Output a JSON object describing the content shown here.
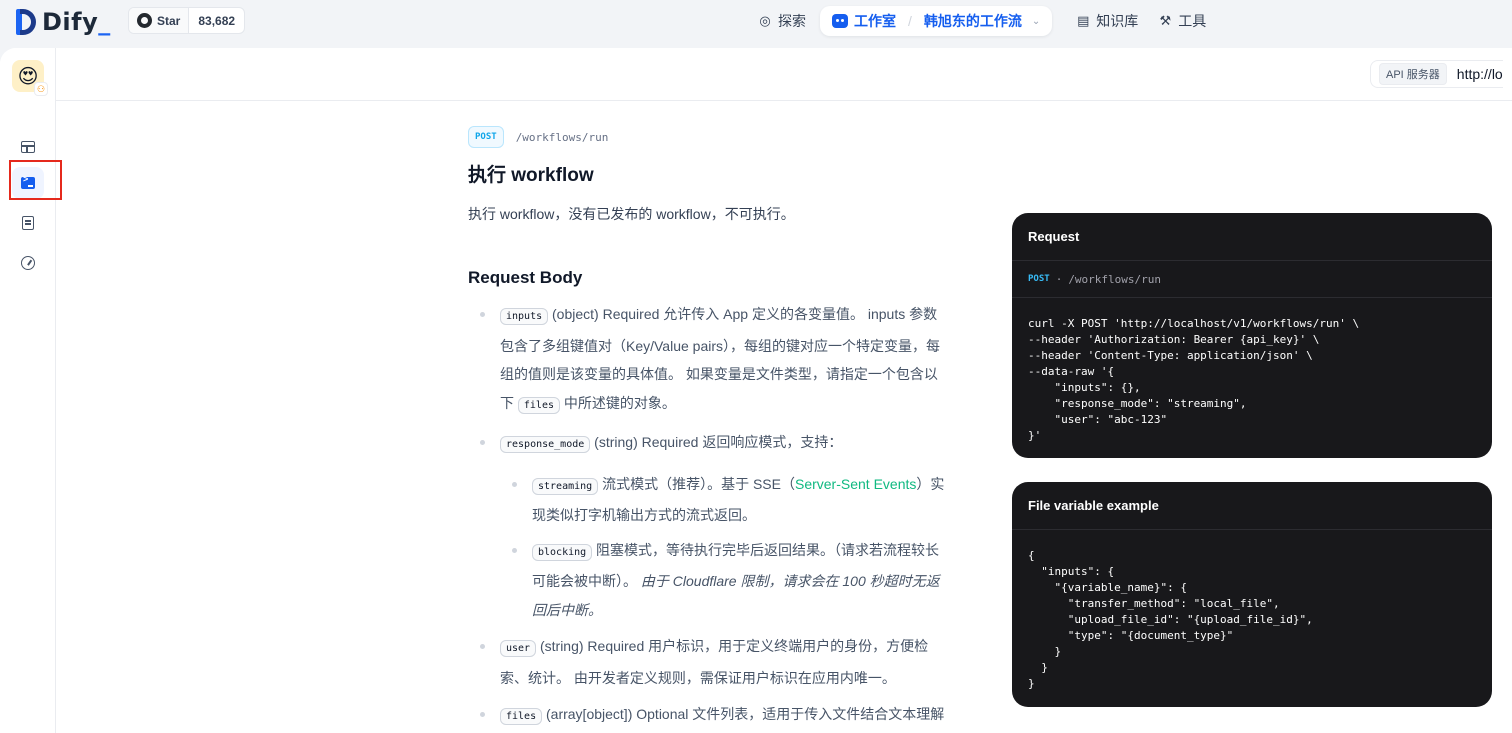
{
  "brand": {
    "name": "Dify",
    "accent": "#155eef"
  },
  "github": {
    "star_label": "Star",
    "star_count": "83,682"
  },
  "nav": {
    "explore": "探索",
    "studio": "工作室",
    "current_app": "韩旭东的工作流",
    "knowledge": "知识库",
    "tools": "工具"
  },
  "api_server": {
    "label": "API 服务器",
    "url": "http://lo"
  },
  "doc": {
    "method": "POST",
    "path": "/workflows/run",
    "title": "执行 workflow",
    "description": "执行 workflow，没有已发布的 workflow，不可执行。",
    "section_title": "Request Body",
    "params": [
      {
        "key": "inputs",
        "text": " (object) Required 允许传入 App 定义的各变量值。 inputs 参数包含了多组键值对（Key/Value pairs），每组的键对应一个特定变量，每组的值则是该变量的具体值。 如果变量是文件类型，请指定一个包含以下 ",
        "key2": "files",
        "text2": " 中所述键的对象。"
      },
      {
        "key": "response_mode",
        "text": " (string) Required 返回响应模式，支持："
      },
      {
        "key": "user",
        "text": " (string) Required 用户标识，用于定义终端用户的身份，方便检索、统计。 由开发者定义规则，需保证用户标识在应用内唯一。"
      },
      {
        "key": "files",
        "text": " (array[object]) Optional 文件列表，适用于传入文件结合文本理解并回答问题，仅当模型支持该类型文件解析能力时可用。"
      }
    ],
    "modes": [
      {
        "key": "streaming",
        "text_a": " 流式模式（推荐）。基于 SSE（",
        "link": "Server-Sent Events",
        "text_b": "）实现类似打字机输出方式的流式返回。"
      },
      {
        "key": "blocking",
        "text_a": " 阻塞模式，等待执行完毕后返回结果。（请求若流程较长可能会被中断）。 ",
        "em": "由于 Cloudflare 限制，请求会在 100 秒超时无返回后中断。"
      }
    ]
  },
  "request_panel": {
    "title": "Request",
    "method": "POST",
    "sep": "·",
    "path": "/workflows/run",
    "code": "curl -X POST 'http://localhost/v1/workflows/run' \\\n--header 'Authorization: Bearer {api_key}' \\\n--header 'Content-Type: application/json' \\\n--data-raw '{\n    \"inputs\": {},\n    \"response_mode\": \"streaming\",\n    \"user\": \"abc-123\"\n}'"
  },
  "file_panel": {
    "title": "File variable example",
    "code": "{\n  \"inputs\": {\n    \"{variable_name}\": {\n      \"transfer_method\": \"local_file\",\n      \"upload_file_id\": \"{upload_file_id}\",\n      \"type\": \"{document_type}\"\n    }\n  }\n}"
  }
}
